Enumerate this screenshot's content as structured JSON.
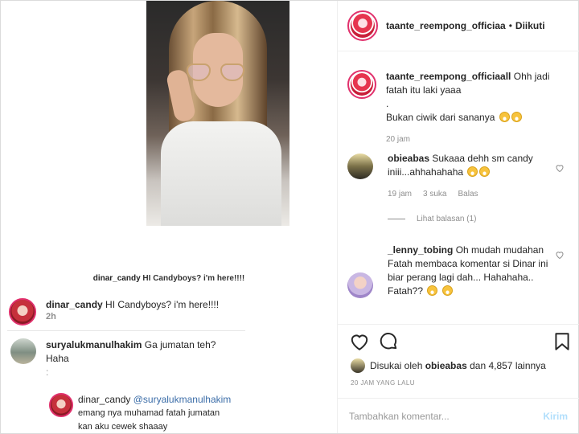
{
  "header": {
    "username": "taante_reempong_officiaa",
    "separator": "•",
    "follow_status": "Diikuti"
  },
  "embedded_post": {
    "caption_center_user": "dinar_candy",
    "caption_center_text": "HI Candyboys? i'm here!!!!",
    "owner_comment_user": "dinar_candy",
    "owner_comment_text": "HI Candyboys? i'm here!!!!",
    "owner_comment_time": "2h",
    "reply1_user": "suryalukmanulhakim",
    "reply1_text": "Ga jumatan teh?",
    "reply1_text2": "Haha",
    "reply1_text3": ":",
    "reply2_user": "dinar_candy",
    "reply2_mention": "@suryalukmanulhakim",
    "reply2_text": "emang nya muhamad fatah jumatan",
    "reply2_text2": "kan aku cewek shaaay"
  },
  "comments": [
    {
      "user": "taante_reempong_officiaall",
      "lines": [
        "Ohh jadi fatah itu laki yaaa",
        ".",
        "Bukan ciwik dari sananya"
      ],
      "time": "20 jam"
    },
    {
      "user": "obieabas",
      "text": "Sukaaa dehh sm candy iniii...ahhahahaha",
      "time": "19 jam",
      "likes": "3 suka",
      "reply": "Balas",
      "view_replies": "Lihat balasan (1)"
    },
    {
      "user": "_lenny_tobing",
      "text": "Oh mudah mudahan Fatah membaca komentar si Dinar ini biar perang lagi dah... Hahahaha.. Fatah??"
    }
  ],
  "likes": {
    "prefix": "Disukai oleh",
    "user": "obieabas",
    "suffix": "dan 4,857 lainnya"
  },
  "time_ago": "20 JAM YANG LALU",
  "add_comment": {
    "placeholder": "Tambahkan komentar...",
    "post_label": "Kirim"
  },
  "colors": {
    "story_ring": "#e1306c",
    "post_button": "#b2dffc",
    "muted": "#8e8e8e"
  },
  "icons": [
    "heart-icon",
    "comment-icon",
    "bookmark-icon"
  ]
}
